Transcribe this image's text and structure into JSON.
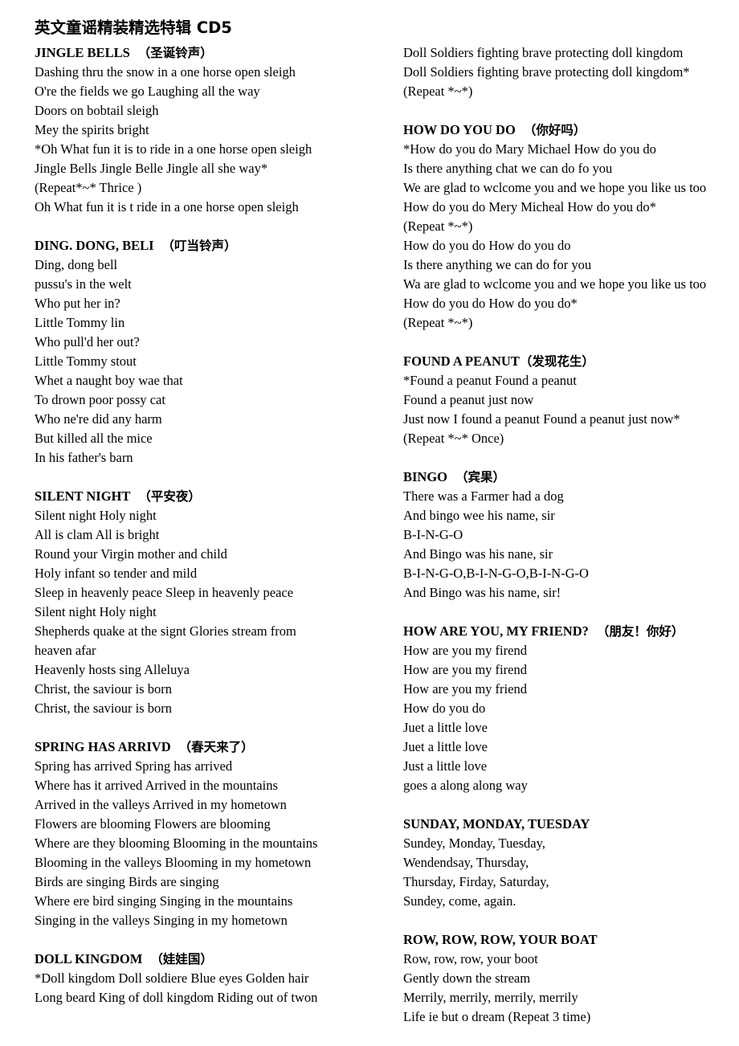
{
  "document": {
    "title": "英文童谣精装精选特辑 CD5"
  },
  "columns": {
    "left": [
      {
        "id": "jingle-bells",
        "heading_en": "JINGLE BELLS",
        "heading_cn": "（圣诞铃声）",
        "heading_gap": "wide",
        "lines": [
          "Dashing thru the snow in a one horse open sleigh",
          "O're the fields we go Laughing all the way",
          "Doors on bobtail sleigh",
          "Mey the spirits bright",
          "*Oh What fun it is to ride in a one horse open sleigh",
          "Jingle Bells Jingle Belle Jingle all she way*",
          "(Repeat*~* Thrice )",
          "Oh What fun it is t ride in a one horse open sleigh"
        ]
      },
      {
        "id": "ding-dong-bell",
        "heading_en": "DING. DONG, BELI",
        "heading_cn": "（叮当铃声）",
        "heading_gap": "wide",
        "lines": [
          "Ding, dong bell",
          "pussu's in the welt",
          "Who put her in?",
          "Little Tommy lin",
          "Who pull'd her out?",
          "Little Tommy stout",
          "Whet a naught boy wae that",
          "To drown poor possy cat",
          "Who ne're did any harm",
          "But killed all the mice",
          "In his father's barn"
        ]
      },
      {
        "id": "silent-night",
        "heading_en": "SILENT NIGHT",
        "heading_cn": "（平安夜）",
        "heading_gap": "wide",
        "lines": [
          "Silent night Holy night",
          "All is clam All is bright",
          "Round your Virgin mother and child",
          "Holy infant so tender and mild",
          "Sleep in heavenly peace Sleep in heavenly peace",
          "Silent night Holy night",
          "Shepherds quake at the signt Glories stream from",
          "heaven afar",
          "Heavenly hosts sing Alleluya",
          "Christ, the saviour is born",
          "Christ, the saviour is born"
        ]
      },
      {
        "id": "spring-has-arrived",
        "heading_en": "SPRING HAS ARRIVD",
        "heading_cn": "（春天来了）",
        "heading_gap": "wide",
        "lines": [
          "Spring has arrived Spring has arrived",
          "Where has it arrived Arrived in the mountains",
          "Arrived in the valleys Arrived in my hometown",
          "Flowers are blooming Flowers are blooming",
          "Where are they blooming Blooming in the mountains",
          "Blooming in the valleys Blooming in my hometown",
          "Birds are singing Birds are singing",
          "Where ere bird singing Singing in the mountains",
          "Singing in the valleys Singing in my hometown"
        ]
      },
      {
        "id": "doll-kingdom",
        "heading_en": "DOLL KINGDOM",
        "heading_cn": "（娃娃国）",
        "heading_gap": "wide",
        "lines": [
          "*Doll kingdom Doll soldiere Blue eyes Golden hair",
          "Long beard King of doll kingdom Riding out of twon"
        ]
      }
    ],
    "right": [
      {
        "id": "doll-kingdom-cont",
        "heading_en": "",
        "heading_cn": "",
        "heading_gap": "none",
        "lines": [
          "Doll Soldiers fighting brave protecting doll kingdom",
          "Doll Soldiers fighting brave protecting doll kingdom*",
          "(Repeat *~*)"
        ]
      },
      {
        "id": "how-do-you-do",
        "heading_en": "HOW DO YOU DO",
        "heading_cn": "（你好吗）",
        "heading_gap": "wide",
        "lines": [
          "*How do you do Mary Michael How do you do",
          "Is there anything chat we can do fo you",
          "We are glad to wclcome you and we hope you like us too",
          "How do you do Mery Micheal How do you do*",
          "(Repeat *~*)",
          "How do you do How do you do",
          "Is there anything we can do for you",
          "Wa are glad to wclcome you and we hope you like us too",
          "How do you do How do you do*",
          "(Repeat *~*)"
        ]
      },
      {
        "id": "found-a-peanut",
        "heading_en": "FOUND A PEANUT",
        "heading_cn": "（发现花生）",
        "heading_gap": "none",
        "lines": [
          "*Found a peanut Found a peanut",
          "Found a peanut just now",
          "Just now I found a peanut Found a peanut just now*",
          "(Repeat *~* Once)"
        ]
      },
      {
        "id": "bingo",
        "heading_en": "BINGO",
        "heading_cn": "（宾果）",
        "heading_gap": "wide",
        "lines": [
          "There was a Farmer had a dog",
          "And bingo wee his name, sir",
          "B-I-N-G-O",
          "And Bingo was his nane, sir",
          "B-I-N-G-O,B-I-N-G-O,B-I-N-G-O",
          "And Bingo was his name, sir!"
        ]
      },
      {
        "id": "how-are-you-my-friend",
        "heading_en": "HOW ARE YOU, MY FRIEND?",
        "heading_cn": "（朋友！你好）",
        "heading_gap": "wide",
        "lines": [
          "How are you my firend",
          "How are you my firend",
          "How are you my friend",
          "How do you do",
          "Juet a little love",
          "Juet a little love",
          "Just a little love",
          "goes a along along way"
        ]
      },
      {
        "id": "sunday-monday-tuesday",
        "heading_en": "SUNDAY, MONDAY, TUESDAY",
        "heading_cn": "",
        "heading_gap": "none",
        "lines": [
          "Sundey, Monday, Tuesday,",
          "Wendendsay, Thursday,",
          "Thursday, Firday, Saturday,",
          "Sundey, come, again."
        ]
      },
      {
        "id": "row-row-row-your-boat",
        "heading_en": "ROW, ROW, ROW, YOUR BOAT",
        "heading_cn": "",
        "heading_gap": "none",
        "lines": [
          "Row, row, row, your boot",
          "Gently down the stream",
          "Merrily, merrily, merrily, merrily",
          "Life ie but o dream (Repeat 3 time)"
        ]
      }
    ]
  }
}
